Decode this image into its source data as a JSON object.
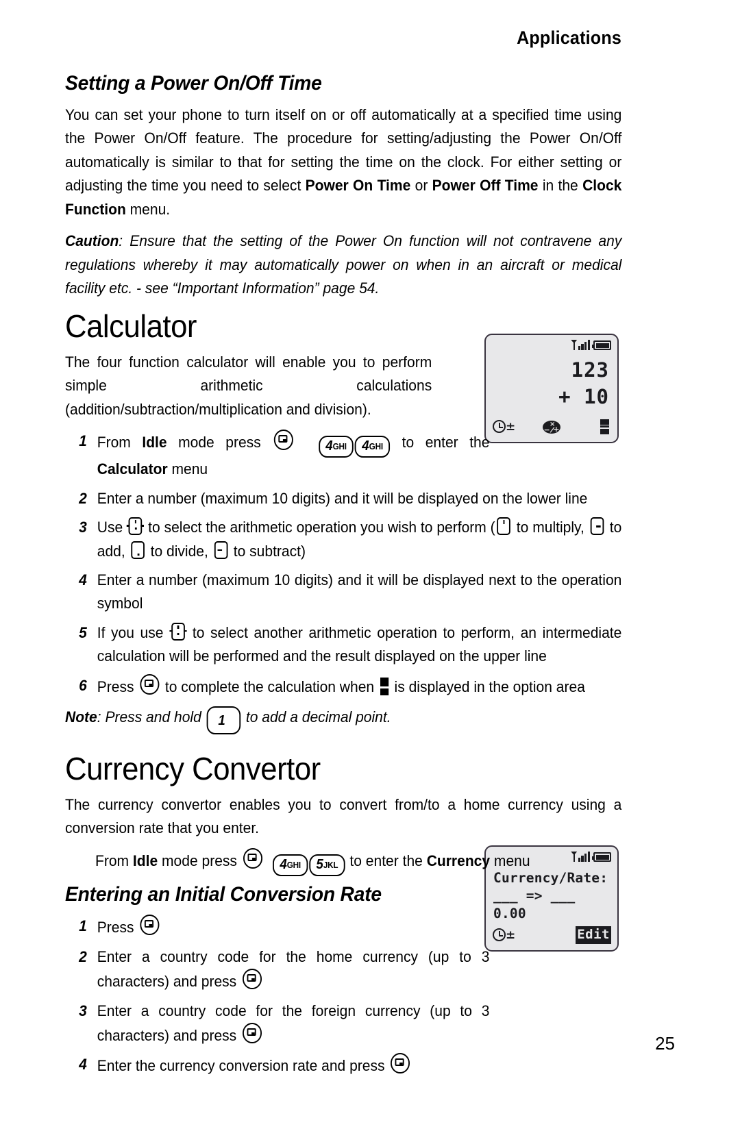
{
  "page": {
    "running_head": "Applications",
    "folio": "25"
  },
  "sections": {
    "power_time": {
      "heading": "Setting a Power On/Off Time",
      "paragraph_1": {
        "part_1": "You can set your phone to turn itself on or off automatically at a specified time using the Power On/Off feature. The procedure for setting/adjusting the Power On/Off automatically is similar to that for setting the time on the clock. For either setting or adjusting the time you need to select ",
        "bold_1": "Power On Time",
        "part_2": " or ",
        "bold_2": "Power Off Time",
        "part_3": " in the ",
        "bold_3": "Clock Function",
        "part_4": " menu."
      },
      "caution": {
        "label": "Caution",
        "text": ": Ensure that the setting of the Power On function will not contravene any regulations whereby it may automatically power on when in an aircraft or medical facility etc. - see “Important Information” page 54."
      }
    },
    "calculator": {
      "heading": "Calculator",
      "intro": "The four function calculator will enable you to perform simple arithmetic calculations (addition/subtraction/multiplication and division).",
      "steps": [
        {
          "num": "1",
          "t1": "From ",
          "b1": "Idle",
          "t2": " mode press ",
          "key_select": "select-key",
          "key_a": {
            "digit": "4",
            "letters": "GHI"
          },
          "key_b": {
            "digit": "4",
            "letters": "GHI"
          },
          "t3": " to enter the ",
          "b2": "Calculator",
          "t4": " menu"
        },
        {
          "num": "2",
          "t1": "Enter a number (maximum 10 digits) and it will be displayed on the lower line"
        },
        {
          "num": "3",
          "t1": "Use ",
          "t2": " to select the arithmetic operation you wish to perform (",
          "t3": " to multiply, ",
          "t4": " to add, ",
          "t5": " to divide, ",
          "t6": " to subtract)"
        },
        {
          "num": "4",
          "t1": "Enter a number (maximum 10 digits) and it will be displayed next to the operation symbol"
        },
        {
          "num": "5",
          "t1": "If you use ",
          "t2": " to select another arithmetic operation to perform, an intermediate calculation will be performed and the result displayed on the upper line"
        },
        {
          "num": "6",
          "t1": "Press ",
          "t2": " to complete the calculation when ",
          "t3": " is displayed in the option area"
        }
      ],
      "note": {
        "label": "Note",
        "t1": ": Press and hold ",
        "key_one": "1",
        "t2": " to add a decimal point."
      },
      "lcd": {
        "upper": "123",
        "lower": "+ 10",
        "softkey_left": "clock-plusminus",
        "softkey_centre": "operator-wheel",
        "softkey_right": "equals"
      }
    },
    "currency": {
      "heading": "Currency Convertor",
      "intro": "The currency convertor enables you to convert from/to a home currency using a conversion rate that you enter.",
      "entry_line": {
        "t1": "From ",
        "b1": "Idle",
        "t2": " mode press ",
        "key_a": {
          "digit": "4",
          "letters": "GHI"
        },
        "key_b": {
          "digit": "5",
          "letters": "JKL"
        },
        "t3": " to enter the ",
        "b2": "Currency",
        "t4": " menu"
      },
      "sub_heading": "Entering an Initial Conversion Rate",
      "steps": [
        {
          "num": "1",
          "t1": "Press "
        },
        {
          "num": "2",
          "t1": "Enter a country code for the home currency (up to 3 characters) and press "
        },
        {
          "num": "3",
          "t1": "Enter a country code for the foreign currency (up to 3 characters) and press "
        },
        {
          "num": "4",
          "t1": "Enter the currency conversion rate and press "
        }
      ],
      "lcd": {
        "line1": "Currency/Rate:",
        "line2": "___ => ___",
        "line3": "0.00",
        "softkey_left": "clock-plusminus",
        "softkey_right": "Edit"
      }
    }
  },
  "colors": {
    "text": "#000000",
    "page_background": "#ffffff",
    "lcd_background": "#e8e8ea",
    "lcd_border": "#3a3440",
    "lcd_ink": "#1b1b1f"
  }
}
